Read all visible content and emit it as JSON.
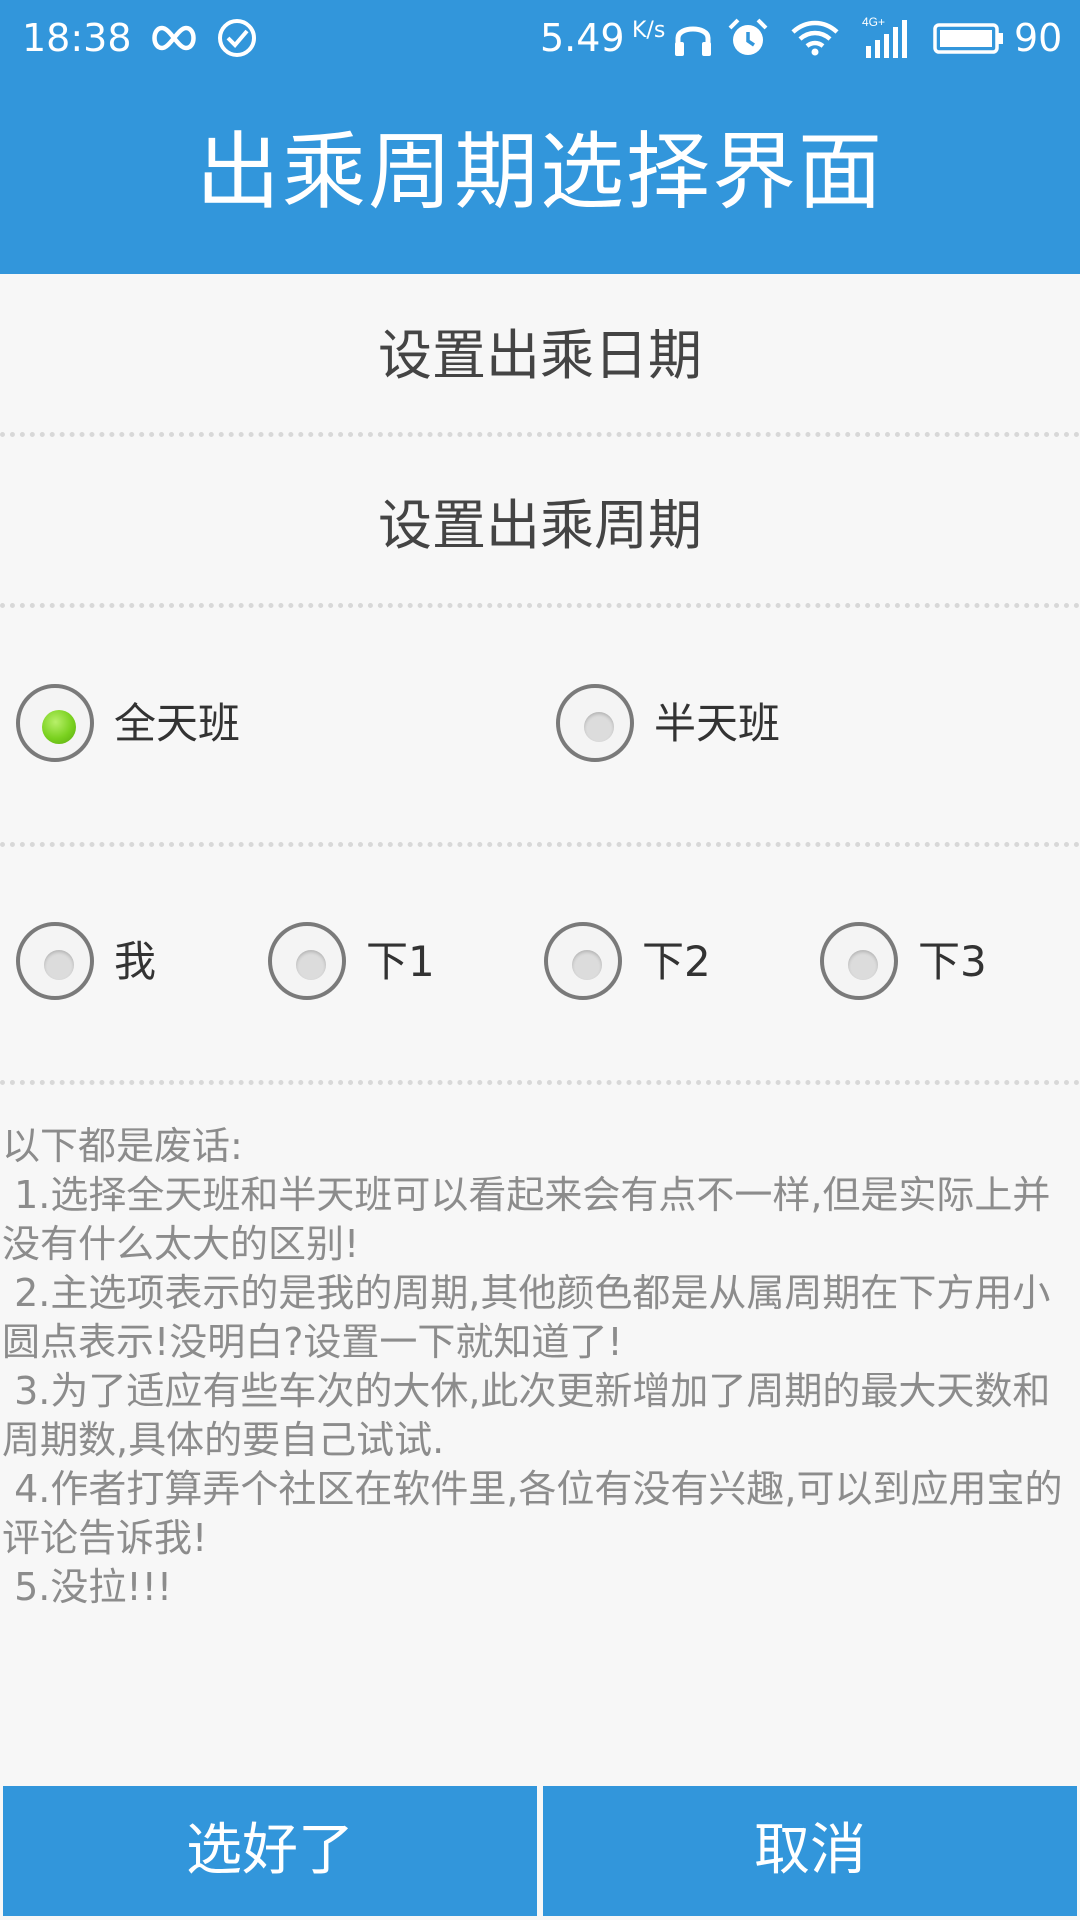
{
  "status_bar": {
    "time": "18:38",
    "speed": "5.49",
    "speed_unit": "K/s",
    "network_label": "4G+",
    "battery_level": "90",
    "icons": [
      "infinity-icon",
      "check-circle-icon",
      "headphones-icon",
      "alarm-icon",
      "wifi-icon",
      "signal-icon",
      "battery-icon"
    ]
  },
  "title_bar": {
    "title": "出乘周期选择界面"
  },
  "settings": {
    "set_date_label": "设置出乘日期",
    "set_cycle_label": "设置出乘周期"
  },
  "shift_type": {
    "options": [
      {
        "label": "全天班",
        "checked": true
      },
      {
        "label": "半天班",
        "checked": false
      }
    ]
  },
  "cycle_member": {
    "options": [
      {
        "label": "我",
        "checked": false
      },
      {
        "label": "下1",
        "checked": false
      },
      {
        "label": "下2",
        "checked": false
      },
      {
        "label": "下3",
        "checked": false
      }
    ]
  },
  "notes": {
    "header": "以下都是废话:",
    "items": [
      " 1.选择全天班和半天班可以看起来会有点不一样,但是实际上并没有什么太大的区别!",
      " 2.主选项表示的是我的周期,其他颜色都是从属周期在下方用小圆点表示!没明白?设置一下就知道了!",
      " 3.为了适应有些车次的大休,此次更新增加了周期的最大天数和周期数,具体的要自己试试.",
      " 4.作者打算弄个社区在软件里,各位有没有兴趣,可以到应用宝的评论告诉我!",
      " 5.没拉!!!"
    ]
  },
  "footer": {
    "confirm_label": "选好了",
    "cancel_label": "取消"
  },
  "colors": {
    "primary": "#3296db",
    "background": "#f7f7f7",
    "radio_checked": "#7ad11f"
  }
}
